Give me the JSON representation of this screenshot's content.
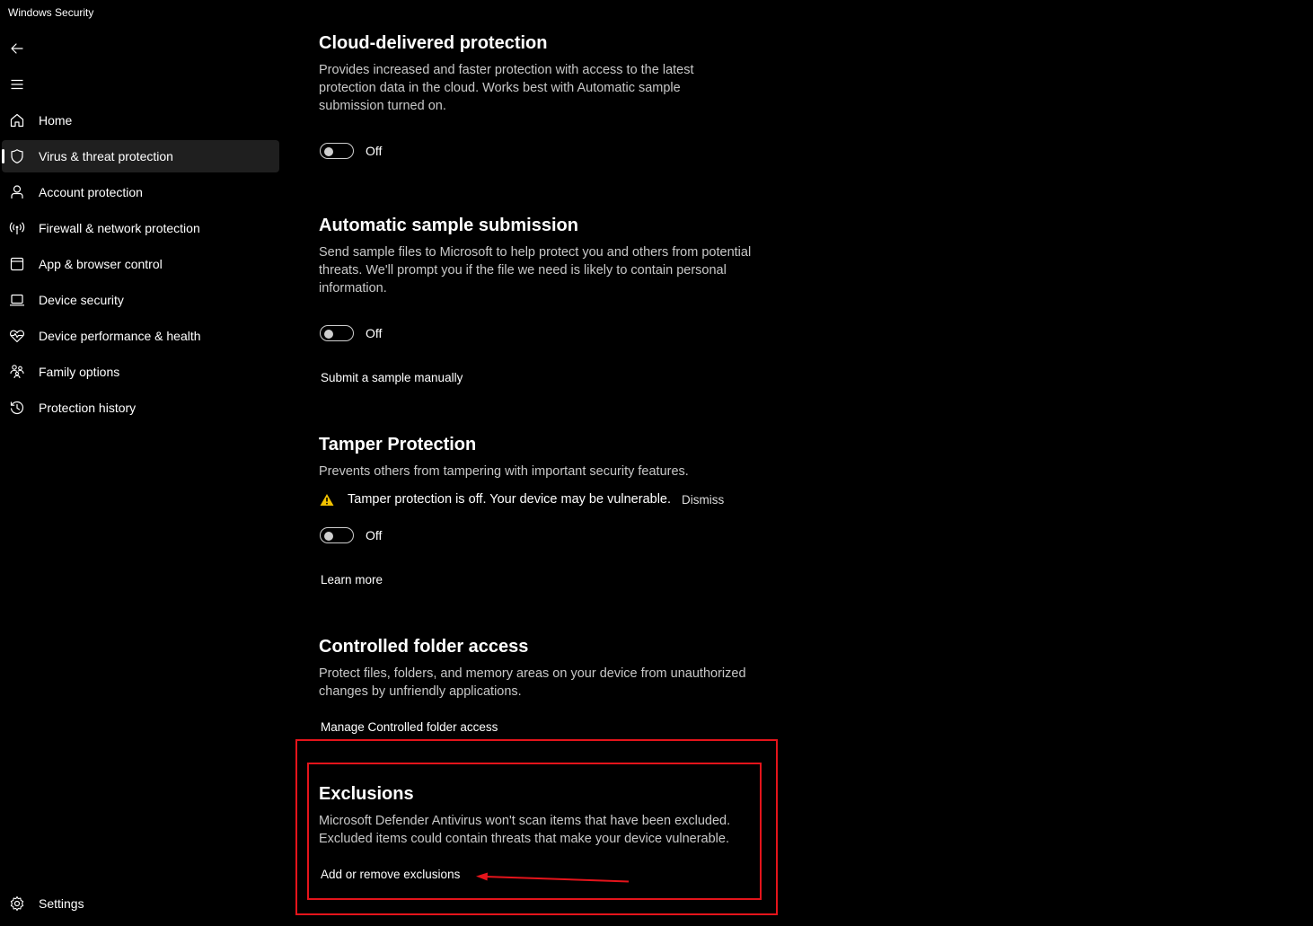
{
  "window": {
    "title": "Windows Security"
  },
  "nav": {
    "back_icon": "back-arrow-icon",
    "menu_icon": "hamburger-menu-icon"
  },
  "sidebar": {
    "items": [
      {
        "label": "Home",
        "icon": "home-icon"
      },
      {
        "label": "Virus & threat protection",
        "icon": "shield-icon",
        "active": true
      },
      {
        "label": "Account protection",
        "icon": "person-icon"
      },
      {
        "label": "Firewall & network protection",
        "icon": "wireless-antenna-icon"
      },
      {
        "label": "App & browser control",
        "icon": "browser-window-icon"
      },
      {
        "label": "Device security",
        "icon": "laptop-icon"
      },
      {
        "label": "Device performance & health",
        "icon": "heart-pulse-icon"
      },
      {
        "label": "Family options",
        "icon": "family-icon"
      },
      {
        "label": "Protection history",
        "icon": "history-icon"
      }
    ],
    "settings_label": "Settings"
  },
  "sections": {
    "cloud": {
      "title": "Cloud-delivered protection",
      "description": "Provides increased and faster protection with access to the latest protection data in the cloud. Works best with Automatic sample submission turned on.",
      "toggle_state": "Off"
    },
    "sample": {
      "title": "Automatic sample submission",
      "description": "Send sample files to Microsoft to help protect you and others from potential threats. We'll prompt you if the file we need is likely to contain personal information.",
      "toggle_state": "Off",
      "link": "Submit a sample manually"
    },
    "tamper": {
      "title": "Tamper Protection",
      "description": "Prevents others from tampering with important security features.",
      "warning": "Tamper protection is off. Your device may be vulnerable.",
      "dismiss": "Dismiss",
      "toggle_state": "Off",
      "link": "Learn more"
    },
    "folder": {
      "title": "Controlled folder access",
      "description": "Protect files, folders, and memory areas on your device from unauthorized changes by unfriendly applications.",
      "link": "Manage Controlled folder access"
    },
    "exclusions": {
      "title": "Exclusions",
      "description": "Microsoft Defender Antivirus won't scan items that have been excluded. Excluded items could contain threats that make your device vulnerable.",
      "link": "Add or remove exclusions"
    }
  },
  "colors": {
    "background": "#000000",
    "annotation": "#e4141b",
    "warning": "#f2c200"
  }
}
